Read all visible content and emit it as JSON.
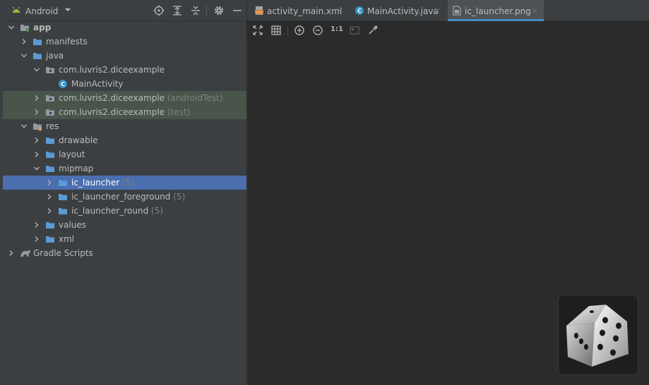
{
  "panel": {
    "view_mode": "Android",
    "tree": [
      {
        "label": "app",
        "level": 0,
        "expanded": true,
        "icon": "module-folder-icon",
        "bold": true
      },
      {
        "label": "manifests",
        "level": 1,
        "expanded": false,
        "icon": "folder-icon"
      },
      {
        "label": "java",
        "level": 1,
        "expanded": true,
        "icon": "folder-icon"
      },
      {
        "label": "com.luvris2.diceexample",
        "level": 2,
        "expanded": true,
        "icon": "package-icon"
      },
      {
        "label": "MainActivity",
        "level": 3,
        "leaf": true,
        "icon": "java-class-icon"
      },
      {
        "label": "com.luvris2.diceexample",
        "suffix": "(androidTest)",
        "level": 2,
        "expanded": false,
        "icon": "package-icon",
        "highlight": "test"
      },
      {
        "label": "com.luvris2.diceexample",
        "suffix": "(test)",
        "level": 2,
        "expanded": false,
        "icon": "package-icon",
        "highlight": "test"
      },
      {
        "label": "res",
        "level": 1,
        "expanded": true,
        "icon": "res-folder-icon"
      },
      {
        "label": "drawable",
        "level": 2,
        "expanded": false,
        "icon": "folder-icon"
      },
      {
        "label": "layout",
        "level": 2,
        "expanded": false,
        "icon": "folder-icon"
      },
      {
        "label": "mipmap",
        "level": 2,
        "expanded": true,
        "icon": "folder-icon"
      },
      {
        "label": "ic_launcher",
        "suffix": "(5)",
        "level": 3,
        "expanded": false,
        "icon": "folder-icon",
        "selected": true
      },
      {
        "label": "ic_launcher_foreground",
        "suffix": "(5)",
        "level": 3,
        "expanded": false,
        "icon": "folder-icon"
      },
      {
        "label": "ic_launcher_round",
        "suffix": "(5)",
        "level": 3,
        "expanded": false,
        "icon": "folder-icon"
      },
      {
        "label": "values",
        "level": 2,
        "expanded": false,
        "icon": "folder-icon"
      },
      {
        "label": "xml",
        "level": 2,
        "expanded": false,
        "icon": "folder-icon"
      },
      {
        "label": "Gradle Scripts",
        "level": 0,
        "expanded": false,
        "icon": "gradle-icon"
      }
    ]
  },
  "editor": {
    "tabs": [
      {
        "label": "activity_main.xml",
        "icon": "xml-file-icon",
        "active": false
      },
      {
        "label": "MainActivity.java",
        "icon": "java-class-icon",
        "active": false
      },
      {
        "label": "ic_launcher.png",
        "icon": "image-file-icon",
        "active": true
      }
    ],
    "close_glyph": "×",
    "zoom_actual_label": "1:1"
  },
  "colors": {
    "panel_bg": "#3c3f41",
    "editor_bg": "#2b2b2b",
    "selection": "#4b6eaf",
    "test_highlight": "#49544a",
    "android_green": "#a4c639",
    "folder_blue": "#5a9bd5",
    "class_teal": "#3592c4",
    "xml_orange": "#d67a2f"
  }
}
